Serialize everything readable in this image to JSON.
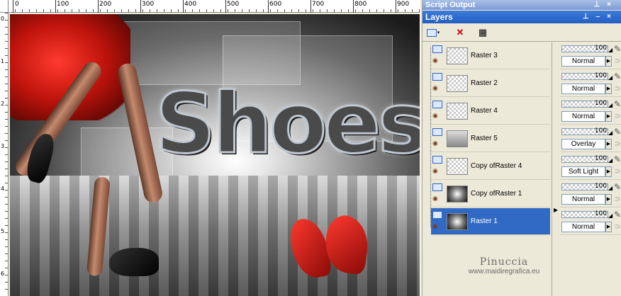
{
  "ruler": {
    "top_ticks": [
      "0",
      "100",
      "200",
      "300",
      "400",
      "500",
      "600",
      "700",
      "800",
      "900"
    ],
    "left_ticks": [
      "0",
      "1",
      "2",
      "3",
      "4",
      "5",
      "6",
      "7",
      "8"
    ]
  },
  "image": {
    "title_text": "Shoes"
  },
  "panels": {
    "script_output_title": "Script Output",
    "layers_title": "Layers"
  },
  "layers": [
    {
      "name": "Raster 3",
      "opacity": "100",
      "blend": "Normal",
      "thumb": "checker"
    },
    {
      "name": "Raster 2",
      "opacity": "100",
      "blend": "Normal",
      "thumb": "checker"
    },
    {
      "name": "Raster 4",
      "opacity": "100",
      "blend": "Normal",
      "thumb": "checker"
    },
    {
      "name": "Raster 5",
      "opacity": "100",
      "blend": "Overlay",
      "thumb": "grey"
    },
    {
      "name": "Copy ofRaster 4",
      "opacity": "100",
      "blend": "Soft Light",
      "thumb": "checker"
    },
    {
      "name": "Copy ofRaster 1",
      "opacity": "100",
      "blend": "Normal",
      "thumb": "grad"
    },
    {
      "name": "Raster 1",
      "opacity": "100",
      "blend": "Normal",
      "thumb": "grad",
      "selected": true
    }
  ],
  "watermark": {
    "name": "Pinuccia",
    "url": "www.maidiregrafica.eu"
  },
  "colors": {
    "selection": "#316ac5",
    "titlebar": "#245ec4"
  }
}
